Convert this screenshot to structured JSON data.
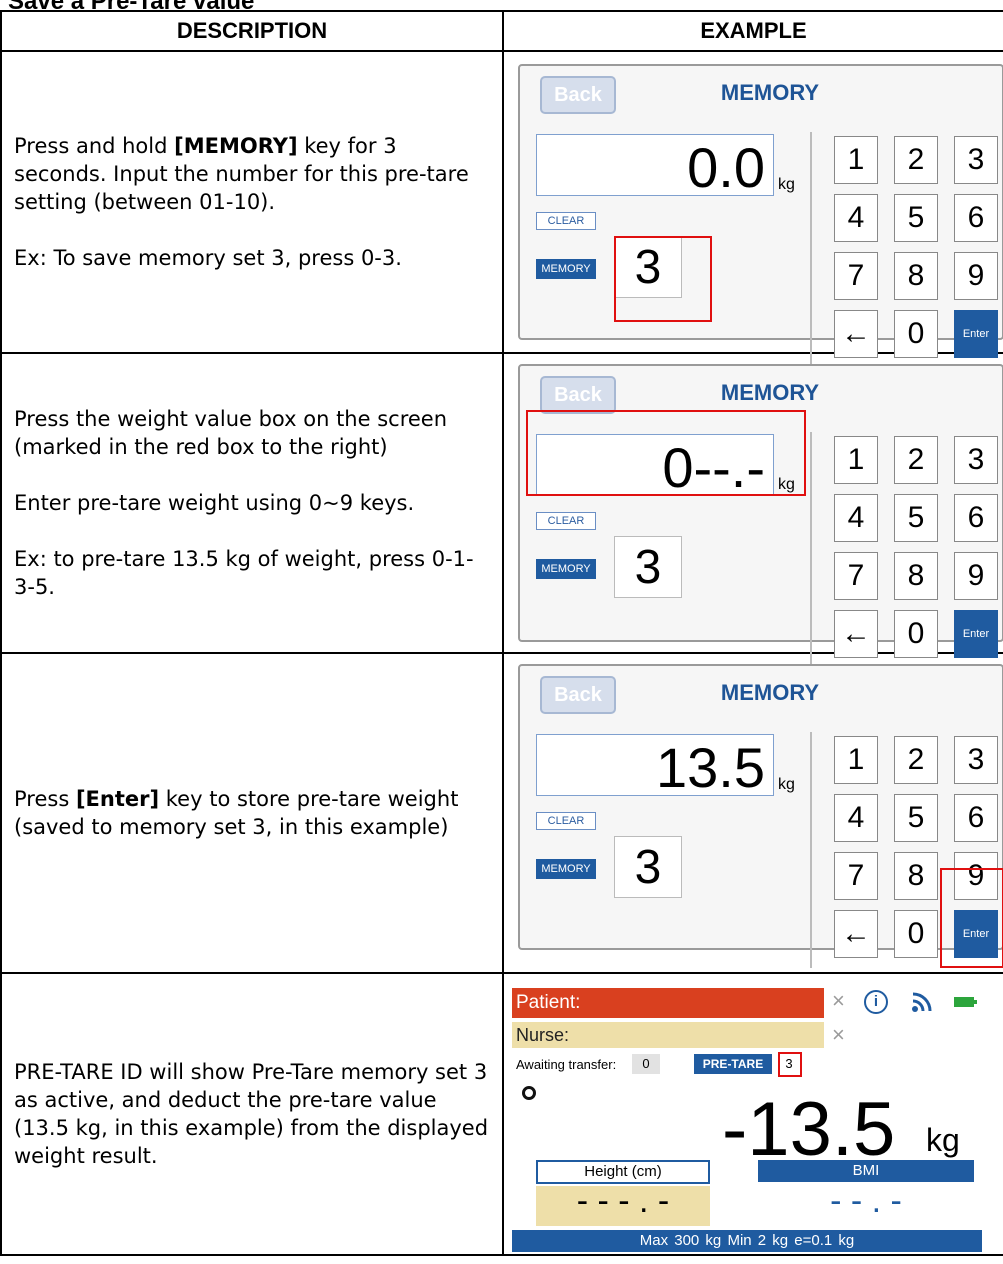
{
  "section_title": "Save a Pre-Tare value",
  "headers": {
    "description": "DESCRIPTION",
    "example": "EXAMPLE"
  },
  "rows": [
    {
      "lines": [
        [
          "Press and hold ",
          "[MEMORY]",
          " key for 3 seconds. Input the number for this pre-tare setting (between 01-10)."
        ],
        [
          "Ex: To save memory set 3, press 0-3."
        ]
      ]
    },
    {
      "lines": [
        [
          "Press the weight value box on the screen (marked in the red box to the right)"
        ],
        [
          "Enter pre-tare weight using 0~9 keys."
        ],
        [
          "Ex: to pre-tare 13.5 kg of weight, press 0-1-3-5."
        ]
      ]
    },
    {
      "lines": [
        [
          "Press ",
          "[Enter]",
          " key to store pre-tare weight (saved to memory set 3, in this example)"
        ]
      ]
    },
    {
      "lines": [
        [
          "PRE-TARE ID will show Pre-Tare memory set 3 as active, and deduct the pre-tare value (13.5 kg, in this example) from the displayed weight result."
        ]
      ]
    }
  ],
  "memory_screens": [
    {
      "back": "Back",
      "title": "MEMORY",
      "weight": "0.0",
      "unit": "kg",
      "clear": "CLEAR",
      "memory_label": "MEMORY",
      "memory_value": "3"
    },
    {
      "back": "Back",
      "title": "MEMORY",
      "weight": "0--.-",
      "unit": "kg",
      "clear": "CLEAR",
      "memory_label": "MEMORY",
      "memory_value": "3"
    },
    {
      "back": "Back",
      "title": "MEMORY",
      "weight": "13.5",
      "unit": "kg",
      "clear": "CLEAR",
      "memory_label": "MEMORY",
      "memory_value": "3"
    }
  ],
  "keypad": [
    "1",
    "2",
    "3",
    "4",
    "5",
    "6",
    "7",
    "8",
    "9",
    "←",
    "0",
    "Enter"
  ],
  "status_screen": {
    "patient": "Patient:",
    "nurse": "Nurse:",
    "close_glyph": "×",
    "awaiting_label": "Awaiting transfer:",
    "awaiting_value": "0",
    "pretare_label": "PRE-TARE",
    "pretare_value": "3",
    "weight": "-13.5",
    "unit": "kg",
    "height_label": "Height (cm)",
    "height_value": "- - - . -",
    "bmi_label": "BMI",
    "bmi_value": "- - . -",
    "footer": "Max 300 kg    Min 2 kg    e=0.1 kg"
  },
  "colors": {
    "brand_blue": "#1f5ba0",
    "patient_red": "#d9401f",
    "nurse_beige": "#eedfa9",
    "highlight_red": "#e01010"
  }
}
